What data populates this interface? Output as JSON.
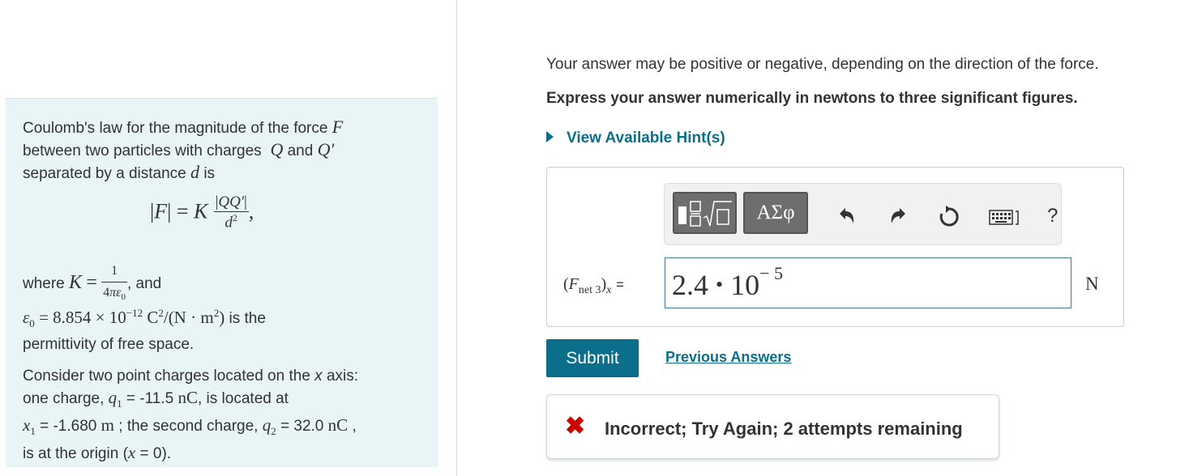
{
  "problem": {
    "intro_1": "Coulomb's law for the magnitude of the force",
    "intro_2": "between two particles with charges",
    "intro_and": "and",
    "intro_3": "separated by a distance",
    "intro_is": "is",
    "where": "where",
    "and2": ", and",
    "is_the": "is the",
    "permittivity": "permittivity of free space.",
    "consider_1": "Consider two point charges located on the",
    "consider_x": "x",
    "consider_axis": "axis:",
    "line2a": "one charge,",
    "q1_value": "= -11.5",
    "q1_unit": "nC",
    "line2b": ", is located at",
    "x1_value": "= -1.680",
    "x1_unit": "m",
    "line3b": "; the second charge,",
    "q2_value": "= 32.0",
    "q2_unit": "nC",
    "line3c": ",",
    "line4": "is at the origin (",
    "line4_eq": "= 0)."
  },
  "instructions": {
    "note": "Your answer may be positive or negative, depending on the direction of the force.",
    "express": "Express your answer numerically in newtons to three significant figures."
  },
  "hint_label": "View Available Hint(s)",
  "toolbar": {
    "templates_icon": "templates-icon",
    "greek_label": "ΑΣφ",
    "undo_icon": "undo-icon",
    "redo_icon": "redo-icon",
    "reset_icon": "reset-icon",
    "keyboard_icon": "keyboard-icon",
    "help_label": "?"
  },
  "answer": {
    "label_sub": "net 3",
    "label_eq": "=",
    "mantissa": "2.4",
    "dot": "•",
    "base": "10",
    "exponent": "− 5",
    "unit": "N"
  },
  "submit_label": "Submit",
  "previous_answers_label": "Previous Answers",
  "feedback": {
    "icon": "✖",
    "text": "Incorrect; Try Again; 2 attempts remaining",
    "color": "#cc0000"
  },
  "colors": {
    "accent": "#0b6f8b",
    "panel_bg": "#e8f4f6"
  }
}
